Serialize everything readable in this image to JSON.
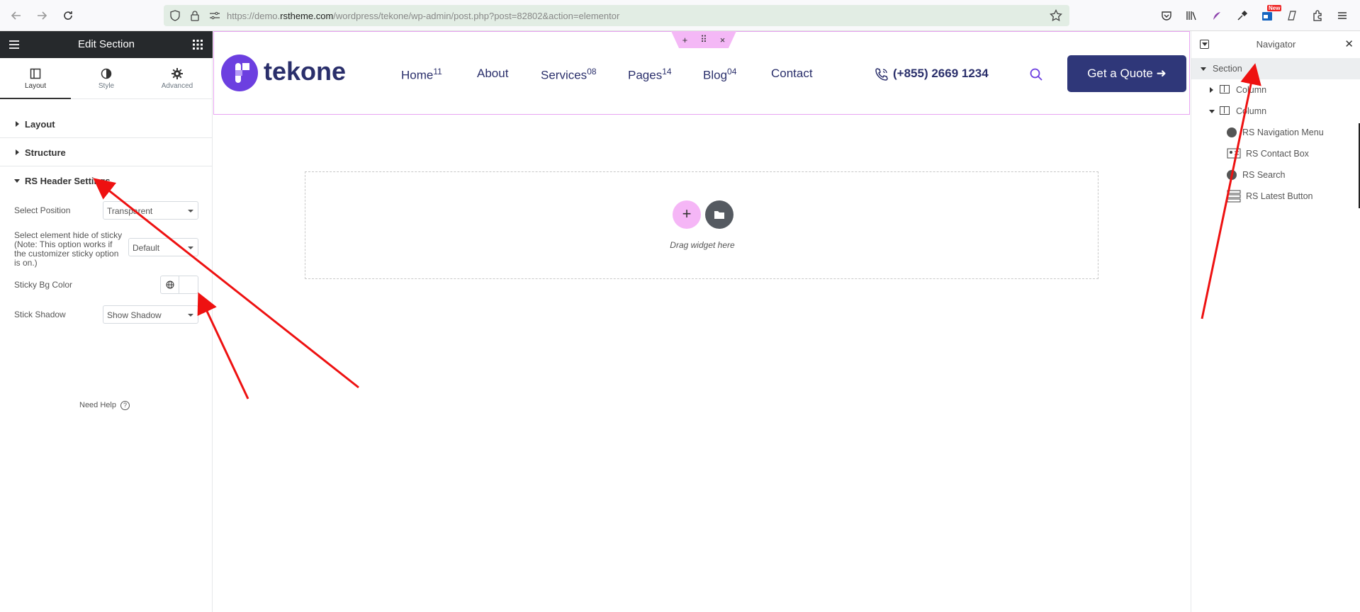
{
  "browser": {
    "url_prefix": "https://demo.",
    "url_domain": "rstheme.com",
    "url_path": "/wordpress/tekone/wp-admin/post.php?post=82802&action=elementor",
    "new_badge": "New"
  },
  "left_panel": {
    "title": "Edit Section",
    "tabs": [
      {
        "label": "Layout",
        "icon": "layout-icon"
      },
      {
        "label": "Style",
        "icon": "style-icon"
      },
      {
        "label": "Advanced",
        "icon": "gear-icon"
      }
    ],
    "sections": {
      "layout": "Layout",
      "structure": "Structure",
      "rs_header": "RS Header Settings"
    },
    "controls": {
      "select_position_label": "Select Position",
      "select_position_value": "Transparent",
      "hide_sticky_label_1": "Select element hide of sticky",
      "hide_sticky_label_2": "(Note: This option works if",
      "hide_sticky_label_3": "the customizer sticky option",
      "hide_sticky_label_4": "is on.)",
      "hide_sticky_value": "Default",
      "sticky_bg_label": "Sticky Bg Color",
      "stick_shadow_label": "Stick Shadow",
      "stick_shadow_value": "Show Shadow"
    },
    "need_help": "Need Help",
    "help_mark": "?"
  },
  "canvas": {
    "handle": {
      "add": "+",
      "move": "⠿",
      "close": "×"
    },
    "logo_text": "tekone",
    "menu": [
      {
        "label": "Home",
        "sup": "11"
      },
      {
        "label": "About",
        "sup": ""
      },
      {
        "label": "Services",
        "sup": "08"
      },
      {
        "label": "Pages",
        "sup": "14"
      },
      {
        "label": "Blog",
        "sup": "04"
      },
      {
        "label": "Contact",
        "sup": ""
      }
    ],
    "phone": "(+855) 2669 1234",
    "quote_button": "Get a Quote",
    "quote_arrow": "➜",
    "add_glyph": "+",
    "drop_text": "Drag widget here",
    "collapse_glyph": "‹"
  },
  "navigator": {
    "title": "Navigator",
    "close_glyph": "✕",
    "items": [
      {
        "label": "Section"
      },
      {
        "label": "Column"
      },
      {
        "label": "Column"
      },
      {
        "label": "RS Navigation Menu"
      },
      {
        "label": "RS Contact Box"
      },
      {
        "label": "RS Search"
      },
      {
        "label": "RS Latest Button"
      }
    ]
  },
  "colors": {
    "accent_red_arrow": "#ee1111",
    "brand_navy": "#2f3779",
    "elementor_pink": "#f4b8f6"
  }
}
